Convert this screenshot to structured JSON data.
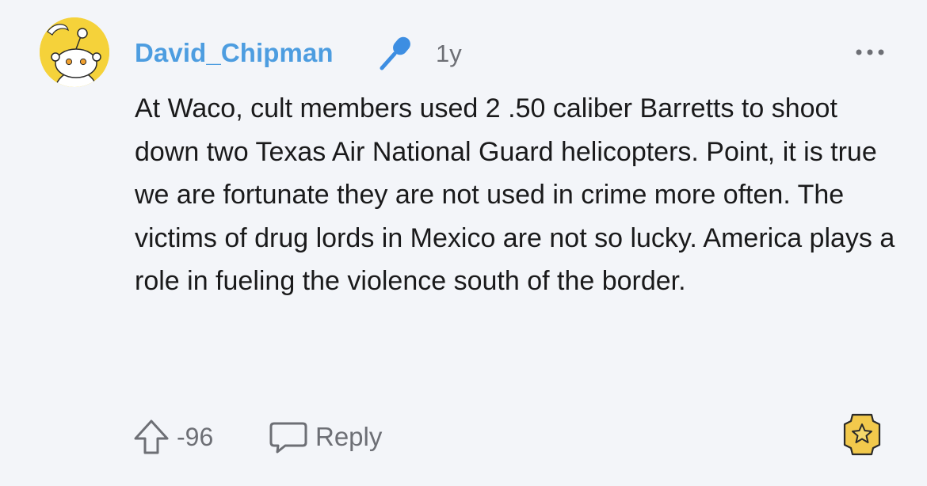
{
  "comment": {
    "username": "David_Chipman",
    "timestamp": "1y",
    "body": "At Waco, cult members used 2 .50 caliber Barretts to shoot down two Texas Air National Guard helicopters. Point, it is true we are fortunate they are not used in crime more often. The victims of drug lords in Mexico are not so lucky. America plays a role in fueling the violence south of the border.",
    "vote_count": "-96",
    "reply_label": "Reply"
  },
  "icons": {
    "avatar": "snoo-avatar",
    "flair": "microphone-icon",
    "more": "more-options-icon",
    "upvote": "upvote-arrow-icon",
    "reply": "speech-bubble-icon",
    "award": "award-icon"
  },
  "colors": {
    "background": "#f3f5f9",
    "username": "#4d9de0",
    "body_text": "#1a1a1b",
    "meta_text": "#6d6f75",
    "avatar_bg": "#f5d23a"
  }
}
